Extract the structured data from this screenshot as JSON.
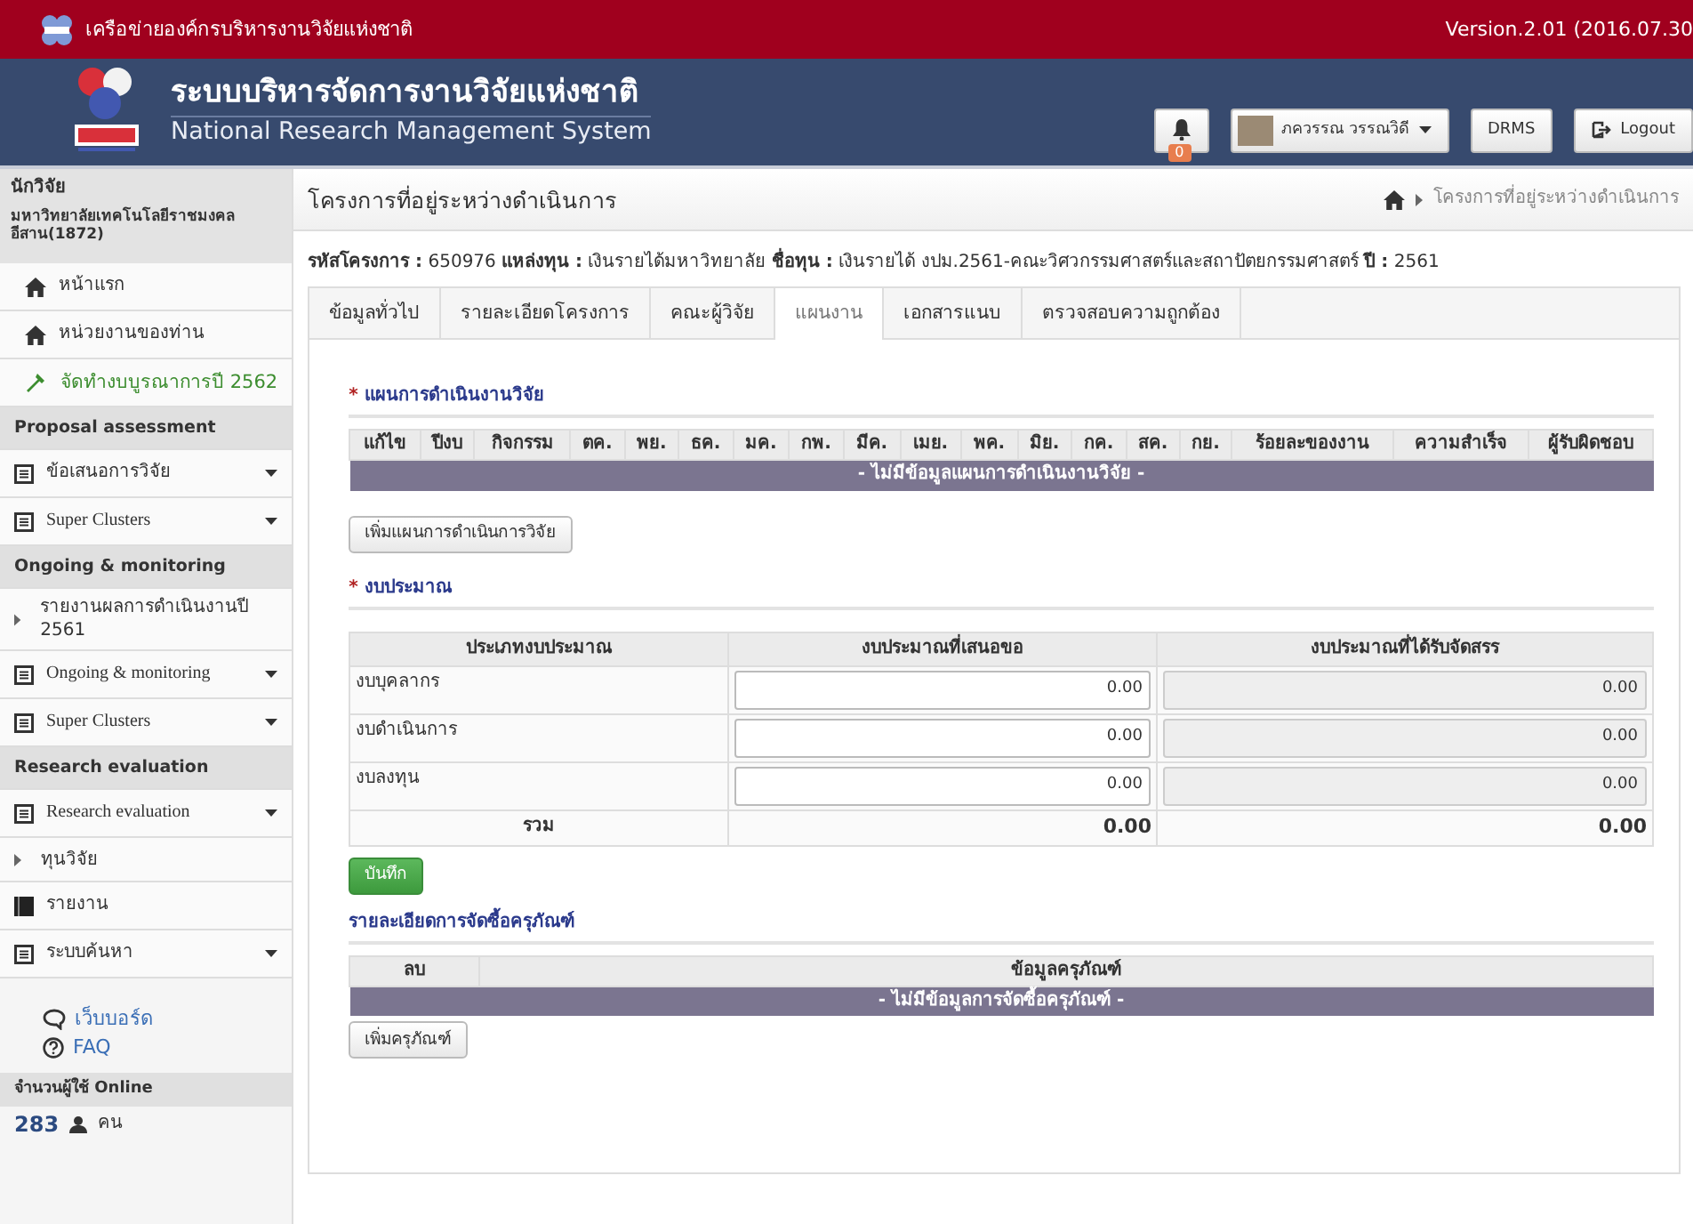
{
  "topbar": {
    "network_name": "เครือข่ายองค์กรบริหารงานวิจัยแห่งชาติ",
    "version": "Version.2.01 (2016.07.30"
  },
  "header": {
    "title": "ระบบบริหารจัดการงานวิจัยแห่งชาติ",
    "subtitle": "National Research Management System",
    "notification_count": "0",
    "user_name": "ภควรรณ วรรณวิดี",
    "buttons": [
      "DRMS",
      "Logout"
    ]
  },
  "sidebar": {
    "role": "นักวิจัย",
    "organization": "มหาวิทยาลัยเทคโนโลยีราชมงคลอีสาน(1872)",
    "items": [
      {
        "kind": "home",
        "label": "หน้าแรก"
      },
      {
        "kind": "home",
        "label": "หน่วยงานของท่าน"
      },
      {
        "kind": "action",
        "label": "จัดทำงบบูรณาการปี 2562"
      },
      {
        "kind": "section",
        "label": "Proposal assessment"
      },
      {
        "kind": "dropdown",
        "label": "ข้อเสนอการวิจัย"
      },
      {
        "kind": "dropdown",
        "label": "Super Clusters"
      },
      {
        "kind": "section",
        "label": "Ongoing & monitoring"
      },
      {
        "kind": "sub",
        "label": "รายงานผลการดำเนินงานปี 2561"
      },
      {
        "kind": "dropdown",
        "label": "Ongoing & monitoring"
      },
      {
        "kind": "dropdown",
        "label": "Super Clusters"
      },
      {
        "kind": "section",
        "label": "Research evaluation"
      },
      {
        "kind": "dropdown",
        "label": "Research evaluation"
      },
      {
        "kind": "sub",
        "label": "ทุนวิจัย"
      },
      {
        "kind": "report",
        "label": "รายงาน"
      },
      {
        "kind": "dropdown",
        "label": "ระบบค้นหา"
      }
    ],
    "links": [
      {
        "kind": "board",
        "label": "เว็บบอร์ด"
      },
      {
        "kind": "help",
        "label": "FAQ"
      }
    ],
    "online": {
      "label": "จำนวนผู้ใช้ Online",
      "count": "283",
      "unit": "คน"
    }
  },
  "main": {
    "page_title": "โครงการที่อยู่ระหว่างดำเนินการ",
    "breadcrumb": "โครงการที่อยู่ระหว่างดำเนินการ",
    "project_info": "**รหัสโครงการ :** 650976 **แหล่งทุน :** เงินรายได้มหาวิทยาลัย **ชื่อทุน :** เงินรายได้ งปม.2561-คณะวิศวกรรมศาสตร์และสถาปัตยกรรมศาสตร์ **ปี :** 2561",
    "tabs": [
      {
        "label": "ข้อมูลทั่วไป",
        "selected": false
      },
      {
        "label": "รายละเอียดโครงการ",
        "selected": false
      },
      {
        "label": "คณะผู้วิจัย",
        "selected": false
      },
      {
        "label": "แผนงาน",
        "selected": true
      },
      {
        "label": "เอกสารแนบ",
        "selected": false
      },
      {
        "label": "ตรวจสอบความถูกต้อง",
        "selected": false
      }
    ],
    "plan": {
      "title": "แผนการดำเนินงานวิจัย",
      "required_mark": "*",
      "columns": [
        "แก้ไข",
        "ปีงบ",
        "กิจกรรม",
        "ตค.",
        "พย.",
        "ธค.",
        "มค.",
        "กพ.",
        "มีค.",
        "เมย.",
        "พค.",
        "มิย.",
        "กค.",
        "สค.",
        "กย.",
        "ร้อยละของงาน",
        "ความสำเร็จ",
        "ผู้รับผิดชอบ"
      ],
      "empty_message": "- ไม่มีข้อมูลแผนการดำเนินงานวิจัย -",
      "add_button": "เพิ่มแผนการดำเนินการวิจัย"
    },
    "budget": {
      "title": "งบประมาณ",
      "required_mark": "*",
      "columns": [
        "ประเภทงบประมาณ",
        "งบประมาณที่เสนอขอ",
        "งบประมาณที่ได้รับจัดสรร"
      ],
      "rows": [
        {
          "label": "งบบุคลากร",
          "requested": {
            "value": "0.00",
            "disabled": false
          },
          "allocated": {
            "value": "0.00",
            "disabled": true
          }
        },
        {
          "label": "งบดำเนินการ",
          "requested": {
            "value": "0.00",
            "disabled": false
          },
          "allocated": {
            "value": "0.00",
            "disabled": true
          }
        },
        {
          "label": "งบลงทุน",
          "requested": {
            "value": "0.00",
            "disabled": false
          },
          "allocated": {
            "value": "0.00",
            "disabled": true
          }
        }
      ],
      "total": {
        "label": "รวม",
        "requested": "0.00",
        "allocated": "0.00"
      },
      "save_button": "บันทึก"
    },
    "equipment": {
      "title": "รายละเอียดการจัดซื้อครุภัณฑ์",
      "columns": [
        "ลบ",
        "ข้อมูลครุภัณฑ์"
      ],
      "empty_message": "- ไม่มีข้อมูลการจัดซื้อครุภัณฑ์ -",
      "add_button": "เพิ่มครุภัณฑ์"
    }
  }
}
